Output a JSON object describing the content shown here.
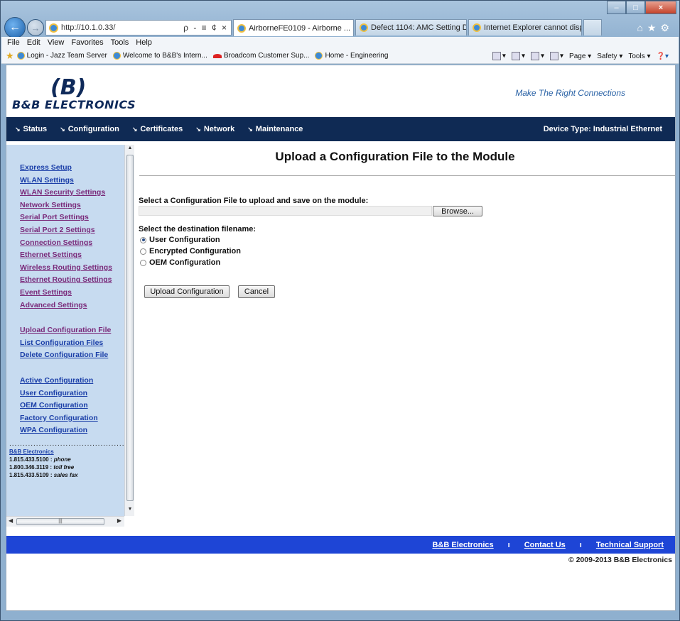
{
  "browser": {
    "address": "http://10.1.0.33/",
    "address_tools": "ρ - ≡ ¢ ×",
    "tabs": [
      {
        "title": "AirborneFE0109 - Airborne ...",
        "active": true
      },
      {
        "title": "Defect 1104: AMC Setting Devi...",
        "active": false
      },
      {
        "title": "Internet Explorer cannot displa...",
        "active": false
      }
    ],
    "menu": [
      "File",
      "Edit",
      "View",
      "Favorites",
      "Tools",
      "Help"
    ],
    "favorites": [
      "Login - Jazz Team Server",
      "Welcome to B&B's Intern...",
      "Broadcom Customer Sup...",
      "Home - Engineering"
    ],
    "command_bar": [
      "Page ▾",
      "Safety ▾",
      "Tools ▾"
    ]
  },
  "header": {
    "logo_mark": "(B)",
    "logo_text": "B&B ELECTRONICS",
    "tagline": "Make The Right Connections"
  },
  "nav": {
    "items": [
      "Status",
      "Configuration",
      "Certificates",
      "Network",
      "Maintenance"
    ],
    "device_type": "Device Type: Industrial Ethernet"
  },
  "sidebar": {
    "group1": [
      "Express Setup",
      "WLAN Settings",
      "WLAN Security Settings",
      "Network Settings",
      "Serial Port Settings",
      "Serial Port 2 Settings",
      "Connection Settings",
      "Ethernet Settings",
      "Wireless Routing Settings",
      "Ethernet Routing Settings",
      "Event Settings",
      "Advanced Settings"
    ],
    "group2": [
      "Upload Configuration File",
      "List Configuration Files",
      "Delete Configuration File"
    ],
    "group3": [
      "Active Configuration",
      "User Configuration",
      "OEM Configuration",
      "Factory Configuration",
      "WPA Configuration"
    ],
    "contact": {
      "company": "B&B Electronics",
      "phone": "1.815.433.5100 :",
      "phone_label": "phone",
      "tollfree": "1.800.346.3119 :",
      "tollfree_label": "toll free",
      "fax": "1.815.433.5109 :",
      "fax_label": "sales fax"
    }
  },
  "content": {
    "title": "Upload a Configuration File to the Module",
    "select_file_label": "Select a Configuration File to upload and save on the module:",
    "file_value": "",
    "browse_label": "Browse...",
    "dest_label": "Select the destination filename:",
    "options": [
      {
        "label": "User Configuration",
        "selected": true
      },
      {
        "label": "Encrypted Configuration",
        "selected": false
      },
      {
        "label": "OEM Configuration",
        "selected": false
      }
    ],
    "upload_button": "Upload Configuration",
    "cancel_button": "Cancel"
  },
  "footer": {
    "links": [
      "B&B Electronics",
      "Contact Us",
      "Technical Support"
    ],
    "separator": "ı",
    "copyright": "© 2009-2013 B&B Electronics"
  },
  "colors": {
    "nav_bg": "#0f2a54",
    "sidebar_bg": "#c7dbf0",
    "footer_bg": "#1e45d6",
    "link": "#1b3fa8"
  }
}
